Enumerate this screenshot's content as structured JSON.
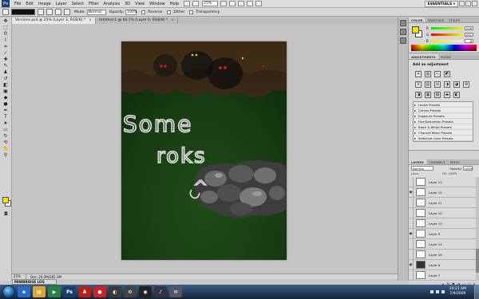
{
  "app": {
    "logo": "Ps",
    "menu": [
      "File",
      "Edit",
      "Image",
      "Layer",
      "Select",
      "Filter",
      "Analysis",
      "3D",
      "View",
      "Window",
      "Help"
    ],
    "zoom_select": "25%",
    "workspace": "ESSENTIALS ▾"
  },
  "options": {
    "mode_label": "Mode:",
    "mode_value": "Normal",
    "opacity_label": "Opacity:",
    "opacity_value": "100%",
    "reverse_label": "Reverse",
    "dither_label": "Dither",
    "transparency_label": "Transparency"
  },
  "documents": [
    {
      "title": "Versions.psd @ 25% (Layer 3, RGB/8) *",
      "active": true
    },
    {
      "title": "Untitled-1 @ 66.7% (Layer 0, RGB/8) *",
      "active": false
    }
  ],
  "canvas_text": {
    "line1": "Some",
    "line2": "roks",
    "line3": "^"
  },
  "status": {
    "zoom": "25%",
    "doc": "Doc: 20.2M/385.3M"
  },
  "minibridge": "MINIBRIDGE LOG",
  "color_panel": {
    "tabs": [
      "COLOR",
      "SWATCHES",
      "STYLES"
    ],
    "r": "236",
    "g": "232",
    "b": "8",
    "fg_color": "#f2e300",
    "bg_color": "#ffffff"
  },
  "adjustments": {
    "tabs": [
      "ADJUSTMENTS",
      "MASKS"
    ],
    "title": "Add an adjustment",
    "presets": [
      "Levels Presets",
      "Curves Presets",
      "Exposure Presets",
      "Hue/Saturation Presets",
      "Black & White Presets",
      "Channel Mixer Presets",
      "Selective Color Presets"
    ]
  },
  "layers_panel": {
    "tabs": [
      "LAYERS",
      "CHANNELS",
      "PATHS"
    ],
    "blend": "Normal",
    "opacity_label": "Opacity:",
    "opacity_value": "100%",
    "lock_label": "Lock:",
    "fill_label": "Fill: 100%",
    "layers": [
      {
        "name": "Layer 13",
        "visible": false,
        "dark": false
      },
      {
        "name": "Layer 12",
        "visible": true,
        "dark": false
      },
      {
        "name": "Layer 11",
        "visible": false,
        "dark": false
      },
      {
        "name": "Layer 10",
        "visible": false,
        "dark": false
      },
      {
        "name": "Layer 15",
        "visible": false,
        "dark": false
      },
      {
        "name": "Layer 9",
        "visible": true,
        "dark": false
      },
      {
        "name": "Layer 14",
        "visible": false,
        "dark": false
      },
      {
        "name": "Layer 16",
        "visible": false,
        "dark": false
      },
      {
        "name": "Layer 8",
        "visible": true,
        "dark": true
      },
      {
        "name": "Layer 7",
        "visible": false,
        "dark": false
      }
    ]
  },
  "taskbar": {
    "time": "10:21 AM",
    "date": "7/9/2009",
    "apps": [
      {
        "label": "e",
        "color": "#2a6bc1"
      },
      {
        "label": "▤",
        "color": "#d8a735"
      },
      {
        "label": "▶",
        "color": "#2d7f3f"
      },
      {
        "label": "Ps",
        "color": "#1b3c70"
      },
      {
        "label": "A",
        "color": "#b32016"
      },
      {
        "label": "●",
        "color": "#c22"
      },
      {
        "label": "◐",
        "color": "#3a3a3a"
      },
      {
        "label": "⚙",
        "color": "#444"
      },
      {
        "label": "◉",
        "color": "#222"
      },
      {
        "label": "♪",
        "color": "#334"
      },
      {
        "label": "✉",
        "color": "#556"
      }
    ]
  }
}
